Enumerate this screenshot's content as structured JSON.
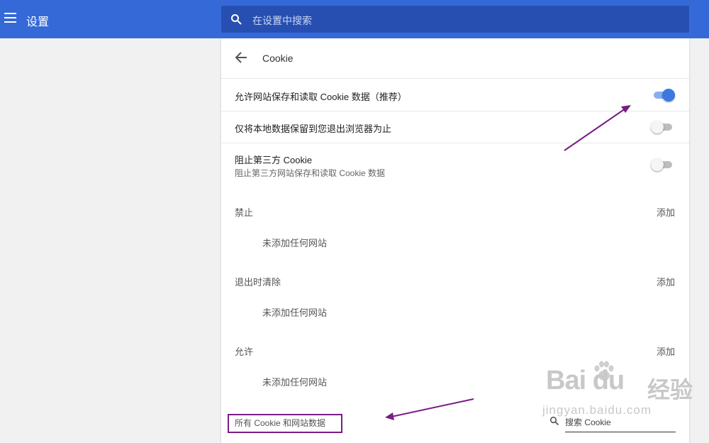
{
  "header": {
    "title": "设置",
    "search_placeholder": "在设置中搜索"
  },
  "page": {
    "title": "Cookie"
  },
  "toggles": [
    {
      "label": "允许网站保存和读取 Cookie 数据（推荐）",
      "enabled": true
    },
    {
      "label": "仅将本地数据保留到您退出浏览器为止",
      "enabled": false
    },
    {
      "label": "阻止第三方 Cookie",
      "sublabel": "阻止第三方网站保存和读取 Cookie 数据",
      "enabled": false
    }
  ],
  "sections": [
    {
      "label": "禁止",
      "add": "添加",
      "empty": "未添加任何网站"
    },
    {
      "label": "退出时清除",
      "add": "添加",
      "empty": "未添加任何网站"
    },
    {
      "label": "允许",
      "add": "添加",
      "empty": "未添加任何网站"
    }
  ],
  "all_cookies": {
    "label": "所有 Cookie 和网站数据",
    "search_placeholder": "搜索 Cookie"
  },
  "watermark": {
    "brand": "Bai du",
    "brand_cn": "经验",
    "url": "jingyan.baidu.com"
  },
  "colors": {
    "header": "#3569d8",
    "toggle_on": "#3d78e0",
    "annotation": "#7a1c86"
  }
}
